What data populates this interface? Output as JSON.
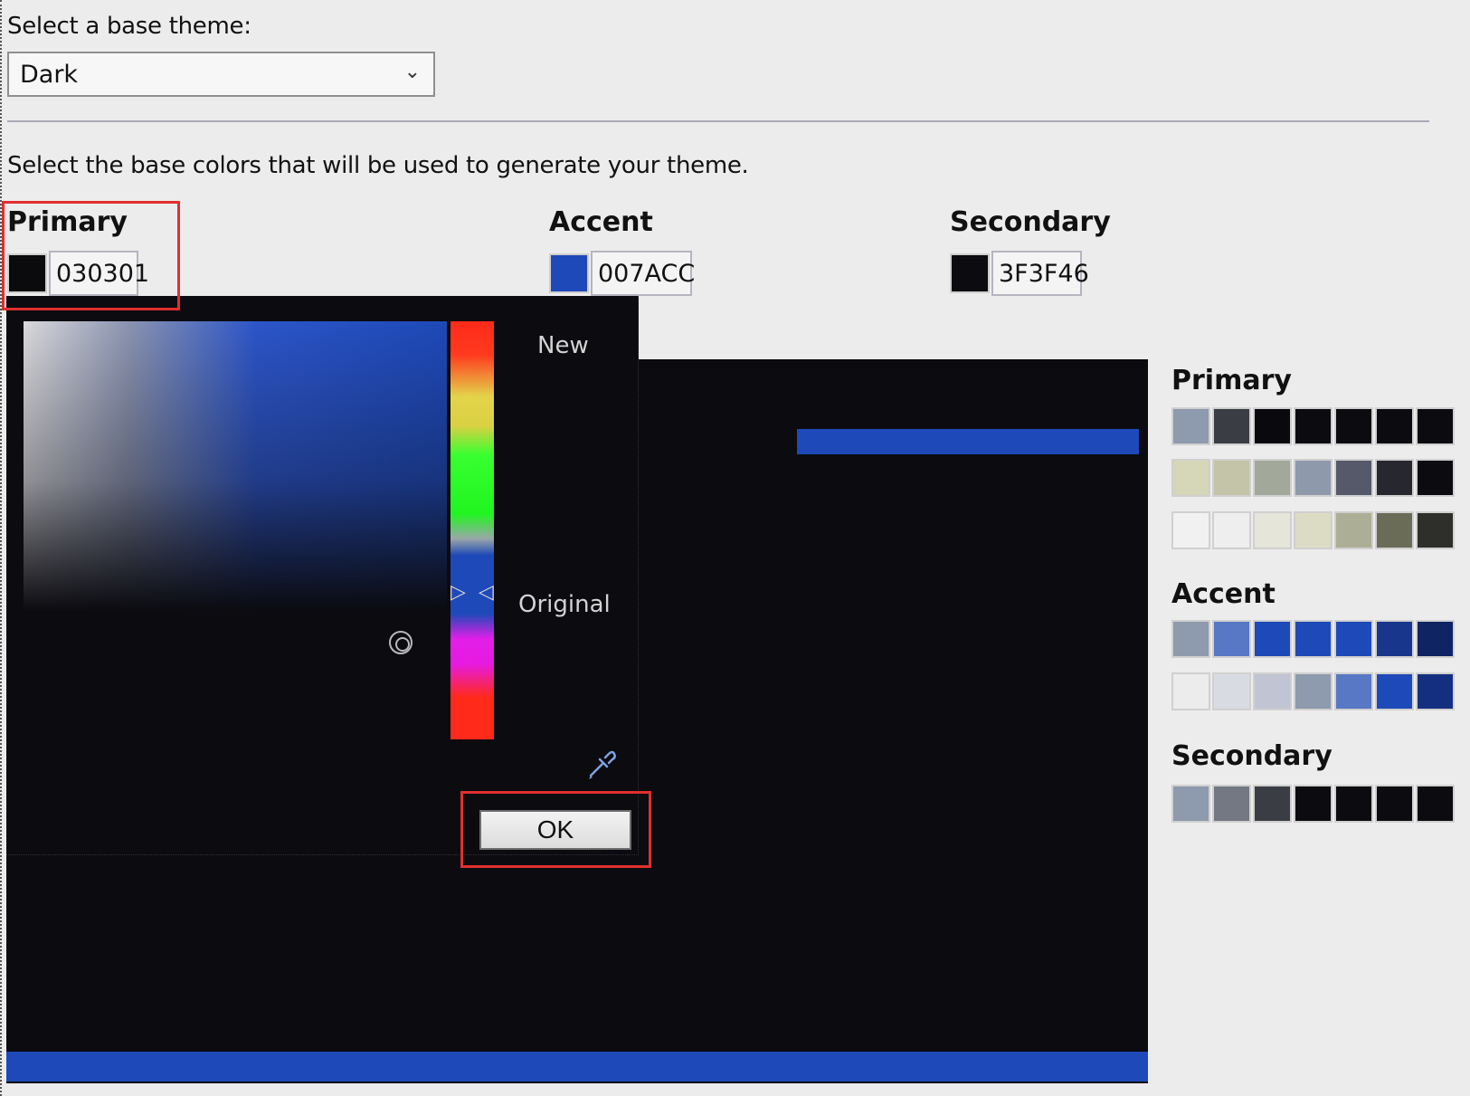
{
  "base_theme": {
    "label": "Select a base theme:",
    "selected": "Dark"
  },
  "instructions": "Select the base colors that will be used to generate your theme.",
  "base_colors": {
    "primary": {
      "label": "Primary",
      "hex": "030301",
      "swatch_color": "#0b0b0d"
    },
    "accent": {
      "label": "Accent",
      "hex": "007ACC",
      "swatch_color": "#1e49b8"
    },
    "secondary": {
      "label": "Secondary",
      "hex": "3F3F46",
      "swatch_color": "#0b0b10"
    }
  },
  "picker": {
    "new_label": "New",
    "original_label": "Original",
    "ok_label": "OK"
  },
  "palette": {
    "primary_label": "Primary",
    "accent_label": "Accent",
    "secondary_label": "Secondary",
    "primary_rows": [
      [
        "#8e9aad",
        "#3b3d45",
        "#0a0a0e",
        "#0b0b10",
        "#0b0b10",
        "#0b0b10",
        "#0b0b10"
      ],
      [
        "#d6d6b8",
        "#c3c4a8",
        "#a3a99a",
        "#8e99ab",
        "#55596a",
        "#27282f",
        "#0b0b10"
      ],
      [
        "#f1f1f1",
        "#eeeeee",
        "#e6e5d9",
        "#dcdcc4",
        "#adae96",
        "#6b6c58",
        "#2e2f2a"
      ]
    ],
    "accent_rows": [
      [
        "#8e9aad",
        "#5877c5",
        "#1e49b8",
        "#1e49b8",
        "#1e49b8",
        "#18368b",
        "#0f2463"
      ],
      [
        "#ececec",
        "#d9dbe2",
        "#c1c5d3",
        "#8e9aad",
        "#5877c5",
        "#1e49b8",
        "#152f80"
      ]
    ],
    "secondary_rows": [
      [
        "#8e9aad",
        "#737883",
        "#3b3d45",
        "#0b0b10",
        "#0b0b10",
        "#0b0b10",
        "#0b0b10"
      ]
    ]
  }
}
